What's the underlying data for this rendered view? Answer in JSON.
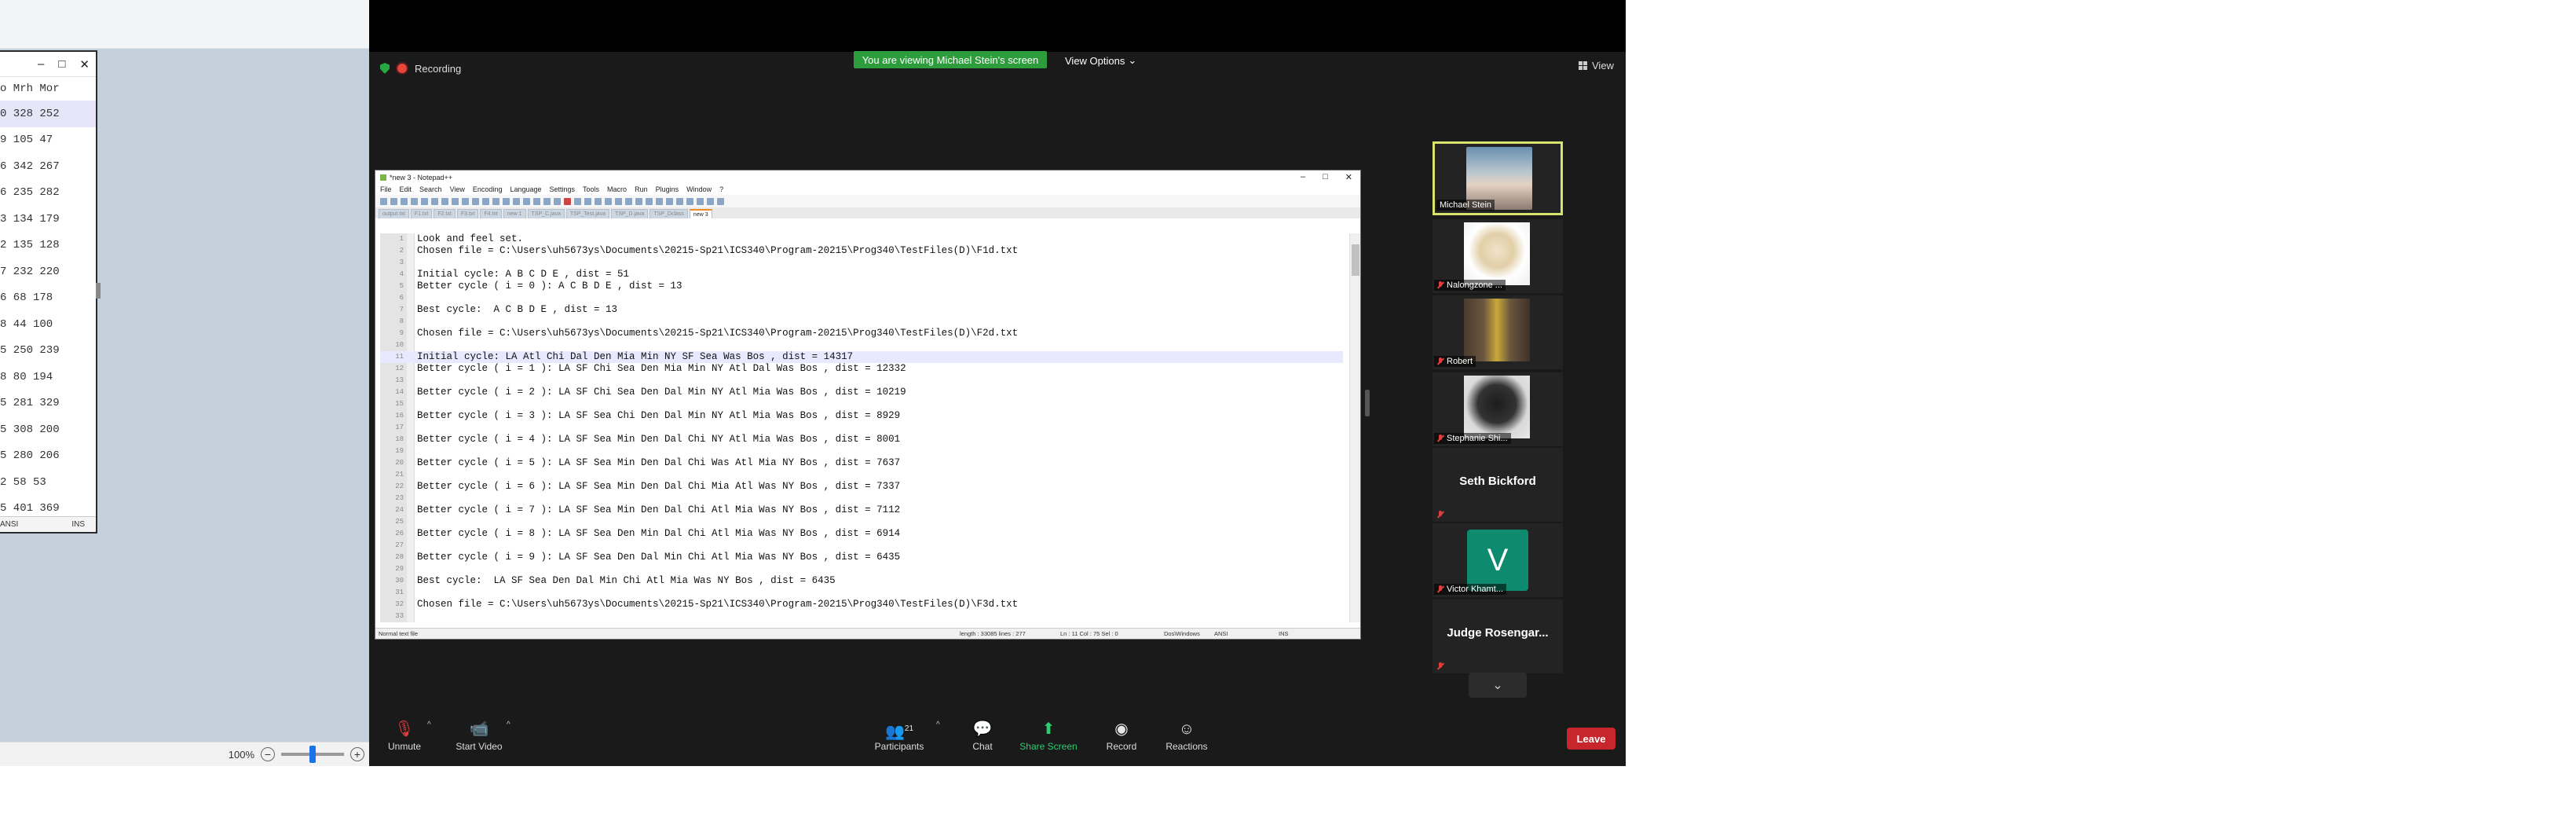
{
  "left_window": {
    "controls": [
      "–",
      "□",
      "✕"
    ],
    "column_header": "o  Mrh Mor",
    "rows": [
      "0  328 252",
      "9  105  47",
      "6  342 267",
      "6  235 282",
      "3  134 179",
      "2  135 128",
      "7  232 220",
      "6   68 178",
      "8   44 100",
      "5  250 239",
      "8   80 194",
      "5  281 329",
      "5  308 200",
      "5  280 206",
      "2   58  53",
      "5  401 369"
    ],
    "status_left": "ANSI",
    "status_right": "INS",
    "zoom_label": "100%"
  },
  "meeting": {
    "recording_label": "Recording",
    "viewing_banner": "You are viewing Michael Stein's screen",
    "view_options_label": "View Options",
    "view_label": "View"
  },
  "notepad": {
    "title": "*new 3 - Notepad++",
    "title_controls": [
      "–",
      "□",
      "✕"
    ],
    "menu": [
      "File",
      "Edit",
      "Search",
      "View",
      "Encoding",
      "Language",
      "Settings",
      "Tools",
      "Macro",
      "Run",
      "Plugins",
      "Window",
      "?"
    ],
    "tabs": [
      "output.txt",
      "F1.txt",
      "F2.txt",
      "F3.txt",
      "F4.txt",
      "new 1",
      "TSP_C.java",
      "TSP_Test.java",
      "TSP_D.java",
      "TSP_Dclass",
      "new 3"
    ],
    "lines": [
      "Look and feel set.",
      "Chosen file = C:\\Users\\uh5673ys\\Documents\\20215-Sp21\\ICS340\\Program-20215\\Prog340\\TestFiles(D)\\F1d.txt",
      "",
      "Initial cycle: A B C D E , dist = 51",
      "Better cycle ( i = 0 ): A C B D E , dist = 13",
      "",
      "Best cycle:  A C B D E , dist = 13",
      "",
      "Chosen file = C:\\Users\\uh5673ys\\Documents\\20215-Sp21\\ICS340\\Program-20215\\Prog340\\TestFiles(D)\\F2d.txt",
      "",
      "Initial cycle: LA Atl Chi Dal Den Mia Min NY SF Sea Was Bos , dist = 14317",
      "Better cycle ( i = 1 ): LA SF Chi Sea Den Mia Min NY Atl Dal Was Bos , dist = 12332",
      "",
      "Better cycle ( i = 2 ): LA SF Chi Sea Den Dal Min NY Atl Mia Was Bos , dist = 10219",
      "",
      "Better cycle ( i = 3 ): LA SF Sea Chi Den Dal Min NY Atl Mia Was Bos , dist = 8929",
      "",
      "Better cycle ( i = 4 ): LA SF Sea Min Den Dal Chi NY Atl Mia Was Bos , dist = 8001",
      "",
      "Better cycle ( i = 5 ): LA SF Sea Min Den Dal Chi Was Atl Mia NY Bos , dist = 7637",
      "",
      "Better cycle ( i = 6 ): LA SF Sea Min Den Dal Chi Mia Atl Was NY Bos , dist = 7337",
      "",
      "Better cycle ( i = 7 ): LA SF Sea Min Den Dal Chi Atl Mia Was NY Bos , dist = 7112",
      "",
      "Better cycle ( i = 8 ): LA SF Sea Den Min Dal Chi Atl Mia Was NY Bos , dist = 6914",
      "",
      "Better cycle ( i = 9 ): LA SF Sea Den Dal Min Chi Atl Mia Was NY Bos , dist = 6435",
      "",
      "Best cycle:  LA SF Sea Den Dal Min Chi Atl Mia Was NY Bos , dist = 6435",
      "",
      "Chosen file = C:\\Users\\uh5673ys\\Documents\\20215-Sp21\\ICS340\\Program-20215\\Prog340\\TestFiles(D)\\F3d.txt",
      ""
    ],
    "current_line_index": 10,
    "status": {
      "type": "Normal text file",
      "length": "length : 33085    lines : 277",
      "pos": "Ln : 11    Col : 75    Sel : 0",
      "eol": "Dos\\Windows",
      "enc": "ANSI",
      "mode": "INS"
    }
  },
  "participants": [
    {
      "name": "Michael Stein",
      "muted": false,
      "active": true
    },
    {
      "name": "Nalongzone ...",
      "muted": true
    },
    {
      "name": "Robert",
      "muted": true
    },
    {
      "name": "Stephanie Shi...",
      "muted": true
    },
    {
      "name": "Seth Bickford",
      "muted": true,
      "big": true
    },
    {
      "name": "Victor Khamt...",
      "muted": true,
      "initial": "V"
    },
    {
      "name": "Judge  Rosengar...",
      "muted": true,
      "big": true
    }
  ],
  "toolbar": {
    "unmute": "Unmute",
    "start_video": "Start Video",
    "participants": "Participants",
    "participants_count": "21",
    "chat": "Chat",
    "share_screen": "Share Screen",
    "record": "Record",
    "reactions": "Reactions",
    "leave": "Leave"
  },
  "colors": {
    "banner_green": "#2d9c3c",
    "leave_red": "#c8262d",
    "active_speaker": "#d7e36c"
  }
}
